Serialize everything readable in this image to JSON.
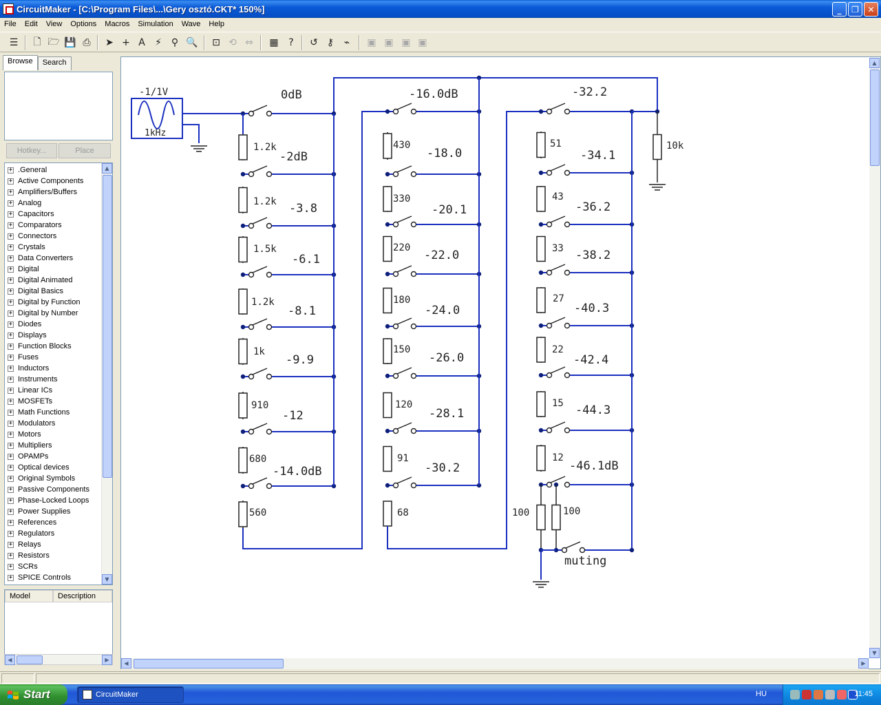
{
  "window": {
    "title": "CircuitMaker - [C:\\Program Files\\...\\Gery osztó.CKT* 150%]",
    "buttons": [
      "_",
      "❐",
      "✕"
    ]
  },
  "menu": [
    "File",
    "Edit",
    "View",
    "Options",
    "Macros",
    "Simulation",
    "Wave",
    "Help"
  ],
  "toolbar": {
    "icons": [
      "panel-toggle-icon",
      "new-file-icon",
      "open-folder-icon",
      "save-icon",
      "print-icon",
      "arrow-tool-icon",
      "wire-tool-icon",
      "text-tool-icon",
      "probe-tool-icon",
      "rubber-stamp-icon",
      "zoom-icon",
      "fit-window-icon",
      "rotate-icon",
      "mirror-icon",
      "digital-sim-icon",
      "help-icon",
      "undo-icon",
      "key-icon",
      "pulse-icon",
      "layout-1-icon",
      "layout-2-icon",
      "layout-3-icon",
      "layout-4-icon"
    ]
  },
  "left_panel": {
    "tabs": [
      "Browse",
      "Search"
    ],
    "hotkey_label": "Hotkey...",
    "place_label": "Place",
    "tree": [
      ".General",
      "Active Components",
      "Amplifiers/Buffers",
      "Analog",
      "Capacitors",
      "Comparators",
      "Connectors",
      "Crystals",
      "Data Converters",
      "Digital",
      "Digital Animated",
      "Digital Basics",
      "Digital by Function",
      "Digital by Number",
      "Diodes",
      "Displays",
      "Function Blocks",
      "Fuses",
      "Inductors",
      "Instruments",
      "Linear ICs",
      "MOSFETs",
      "Math Functions",
      "Modulators",
      "Motors",
      "Multipliers",
      "OPAMPs",
      "Optical devices",
      "Original Symbols",
      "Passive Components",
      "Phase-Locked Loops",
      "Power Supplies",
      "References",
      "Regulators",
      "Relays",
      "Resistors",
      "SCRs",
      "SPICE Controls"
    ],
    "model_columns": [
      "Model",
      "Description"
    ]
  },
  "schematic": {
    "source": {
      "amplitude": "-1/1V",
      "freq": "1kHz"
    },
    "col1": {
      "resistors": [
        "1.2k",
        "1.2k",
        "1.5k",
        "1.2k",
        "1k",
        "910",
        "680",
        "560"
      ],
      "switches": [
        "0dB",
        "-2dB",
        "-3.8",
        "-6.1",
        "-8.1",
        "-9.9",
        "-12",
        "-14.0dB"
      ]
    },
    "col2": {
      "resistors": [
        "430",
        "330",
        "220",
        "180",
        "150",
        "120",
        "91",
        "68"
      ],
      "switches": [
        "-16.0dB",
        "-18.0",
        "-20.1",
        "-22.0",
        "-24.0",
        "-26.0",
        "-28.1",
        "-30.2"
      ]
    },
    "col3": {
      "resistors": [
        "51",
        "43",
        "33",
        "27",
        "22",
        "15",
        "12",
        "100",
        "100"
      ],
      "switches": [
        "-32.2",
        "-34.1",
        "-36.2",
        "-38.2",
        "-40.3",
        "-42.4",
        "-44.3",
        "-46.1dB"
      ],
      "muting": "muting"
    },
    "load": "10k"
  },
  "taskbar": {
    "start": "Start",
    "task": "CircuitMaker",
    "lang": "HU",
    "clock": "11:45"
  }
}
